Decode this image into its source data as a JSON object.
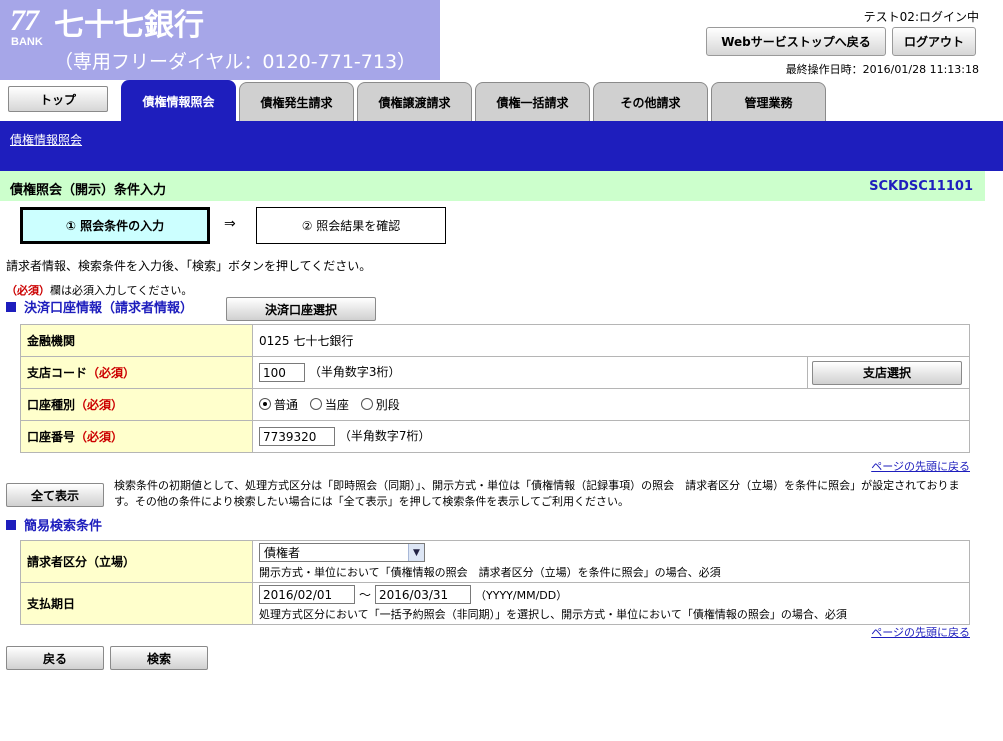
{
  "header": {
    "logo_number": "77",
    "logo_bank": "BANK",
    "bank_name": "七十七銀行",
    "dial": "（専用フリーダイヤル：0120-771-713）",
    "login_status": "テスト02:ログイン中",
    "webtop_label": "Webサービストップへ戻る",
    "logout_label": "ログアウト",
    "last_operation": "最終操作日時：2016/01/28 11:13:18"
  },
  "tabs": {
    "top": "トップ",
    "items": [
      "債権情報照会",
      "債権発生請求",
      "債権譲渡請求",
      "債権一括請求",
      "その他請求",
      "管理業務"
    ],
    "active": "債権情報照会"
  },
  "breadcrumb": "債権情報照会",
  "page": {
    "title": "債権照会（開示）条件入力",
    "screen_id": "SCKDSC11101"
  },
  "steps": {
    "step1": "① 照会条件の入力",
    "arrow": "⇒",
    "step2": "② 照会結果を確認"
  },
  "instruction": "請求者情報、検索条件を入力後、「検索」ボタンを押してください。",
  "required_note": {
    "mark": "（必須）",
    "text": "欄は必須入力してください。"
  },
  "account_section": {
    "title": "決済口座情報（請求者情報）",
    "select_button": "決済口座選択",
    "rows": {
      "bank_label": "金融機関",
      "bank_value": "0125 七十七銀行",
      "branch_label": "支店コード",
      "branch_value": "100",
      "branch_hint": "（半角数字3桁）",
      "branch_button": "支店選択",
      "type_label": "口座種別",
      "type_options": [
        "普通",
        "当座",
        "別段"
      ],
      "type_selected": "普通",
      "number_label": "口座番号",
      "number_value": "7739320",
      "number_hint": "（半角数字7桁）"
    },
    "required_mark": "（必須）"
  },
  "page_top_link": "ページの先頭に戻る",
  "show_all_button": "全て表示",
  "notice": "検索条件の初期値として、処理方式区分は「即時照会（同期）」、開示方式・単位は「債権情報（記録事項）の照会　請求者区分（立場）を条件に照会」が設定されております。その他の条件により検索したい場合には「全て表示」を押して検索条件を表示してご利用ください。",
  "simple_search": {
    "title": "簡易検索条件",
    "requester_label": "請求者区分（立場）",
    "requester_value": "債権者",
    "requester_note": "開示方式・単位において「債権情報の照会　請求者区分（立場）を条件に照会」の場合、必須",
    "due_label": "支払期日",
    "due_from": "2016/02/01",
    "due_tilde": "～",
    "due_to": "2016/03/31",
    "due_format": "（YYYY/MM/DD）",
    "due_note": "処理方式区分において「一括予約照会（非同期）」を選択し、開示方式・単位において「債権情報の照会」の場合、必須"
  },
  "footer_buttons": {
    "back": "戻る",
    "search": "検索"
  }
}
